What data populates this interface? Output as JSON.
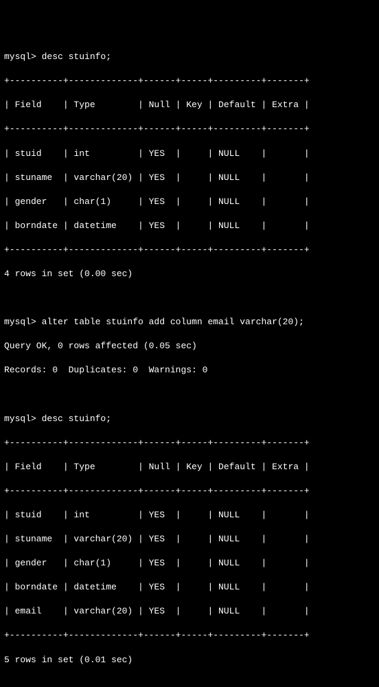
{
  "block1": {
    "prompt": "mysql> desc stuinfo;",
    "border": "+----------+-------------+------+-----+---------+-------+",
    "header": "| Field    | Type        | Null | Key | Default | Extra |",
    "rows": [
      "| stuid    | int         | YES  |     | NULL    |       |",
      "| stuname  | varchar(20) | YES  |     | NULL    |       |",
      "| gender   | char(1)     | YES  |     | NULL    |       |",
      "| borndate | datetime    | YES  |     | NULL    |       |"
    ],
    "footer": "4 rows in set (0.00 sec)"
  },
  "block2": {
    "prompt": "mysql> alter table stuinfo add column email varchar(20);",
    "result1": "Query OK, 0 rows affected (0.05 sec)",
    "result2": "Records: 0  Duplicates: 0  Warnings: 0"
  },
  "block3": {
    "prompt": "mysql> desc stuinfo;",
    "border": "+----------+-------------+------+-----+---------+-------+",
    "header": "| Field    | Type        | Null | Key | Default | Extra |",
    "rows": [
      "| stuid    | int         | YES  |     | NULL    |       |",
      "| stuname  | varchar(20) | YES  |     | NULL    |       |",
      "| gender   | char(1)     | YES  |     | NULL    |       |",
      "| borndate | datetime    | YES  |     | NULL    |       |",
      "| email    | varchar(20) | YES  |     | NULL    |       |"
    ],
    "footer": "5 rows in set (0.01 sec)"
  },
  "chart_data": {
    "type": "table",
    "title": "MySQL DESCRIBE output before and after ALTER TABLE",
    "tables": [
      {
        "command": "desc stuinfo",
        "columns": [
          "Field",
          "Type",
          "Null",
          "Key",
          "Default",
          "Extra"
        ],
        "rows": [
          [
            "stuid",
            "int",
            "YES",
            "",
            "NULL",
            ""
          ],
          [
            "stuname",
            "varchar(20)",
            "YES",
            "",
            "NULL",
            ""
          ],
          [
            "gender",
            "char(1)",
            "YES",
            "",
            "NULL",
            ""
          ],
          [
            "borndate",
            "datetime",
            "YES",
            "",
            "NULL",
            ""
          ]
        ],
        "footer": "4 rows in set (0.00 sec)"
      },
      {
        "command": "alter table stuinfo add column email varchar(20)",
        "result": "Query OK, 0 rows affected (0.05 sec); Records: 0  Duplicates: 0  Warnings: 0"
      },
      {
        "command": "desc stuinfo",
        "columns": [
          "Field",
          "Type",
          "Null",
          "Key",
          "Default",
          "Extra"
        ],
        "rows": [
          [
            "stuid",
            "int",
            "YES",
            "",
            "NULL",
            ""
          ],
          [
            "stuname",
            "varchar(20)",
            "YES",
            "",
            "NULL",
            ""
          ],
          [
            "gender",
            "char(1)",
            "YES",
            "",
            "NULL",
            ""
          ],
          [
            "borndate",
            "datetime",
            "YES",
            "",
            "NULL",
            ""
          ],
          [
            "email",
            "varchar(20)",
            "YES",
            "",
            "NULL",
            ""
          ]
        ],
        "footer": "5 rows in set (0.01 sec)"
      }
    ]
  }
}
